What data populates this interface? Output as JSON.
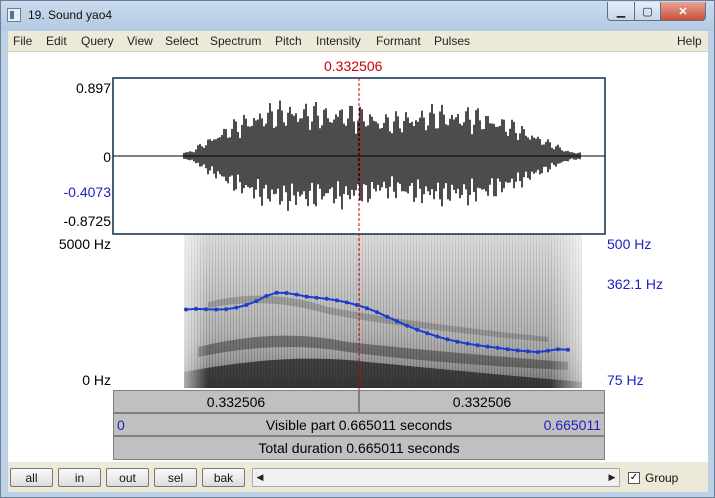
{
  "window": {
    "title": "19. Sound yao4"
  },
  "menu": [
    "File",
    "Edit",
    "Query",
    "View",
    "Select",
    "Spectrum",
    "Pitch",
    "Intensity",
    "Formant",
    "Pulses"
  ],
  "help": "Help",
  "cursor": {
    "time": "0.332506"
  },
  "waveform": {
    "max": "0.897",
    "zero": "0",
    "cursor_value": "-0.4073",
    "min": "-0.8725"
  },
  "spectrogram": {
    "freq_top": "5000 Hz",
    "freq_bottom": "0 Hz"
  },
  "pitch": {
    "top": "500 Hz",
    "cursor_value": "362.1 Hz",
    "bottom": "75 Hz",
    "contour_hz": [
      292,
      294,
      293,
      292,
      293,
      298,
      306,
      318,
      334,
      344,
      343,
      338,
      332,
      328,
      325,
      320,
      314,
      306,
      296,
      284,
      270,
      256,
      242,
      230,
      219,
      209,
      200,
      193,
      187,
      182,
      178,
      174,
      170,
      166,
      163,
      161,
      165,
      170,
      168
    ]
  },
  "time_bar": {
    "left_segment": "0.332506",
    "right_segment": "0.332506"
  },
  "visible_bar": {
    "start": "0",
    "text": "Visible part 0.665011 seconds",
    "end": "0.665011"
  },
  "total_bar": {
    "text": "Total duration 0.665011 seconds"
  },
  "buttons": {
    "all": "all",
    "in": "in",
    "out": "out",
    "sel": "sel",
    "bak": "bak"
  },
  "group": {
    "label": "Group",
    "checked": true
  },
  "colors": {
    "cursor_red": "#cc0000",
    "pitch_blue": "#1f3ccc",
    "axis_blue": "#2020c0"
  }
}
